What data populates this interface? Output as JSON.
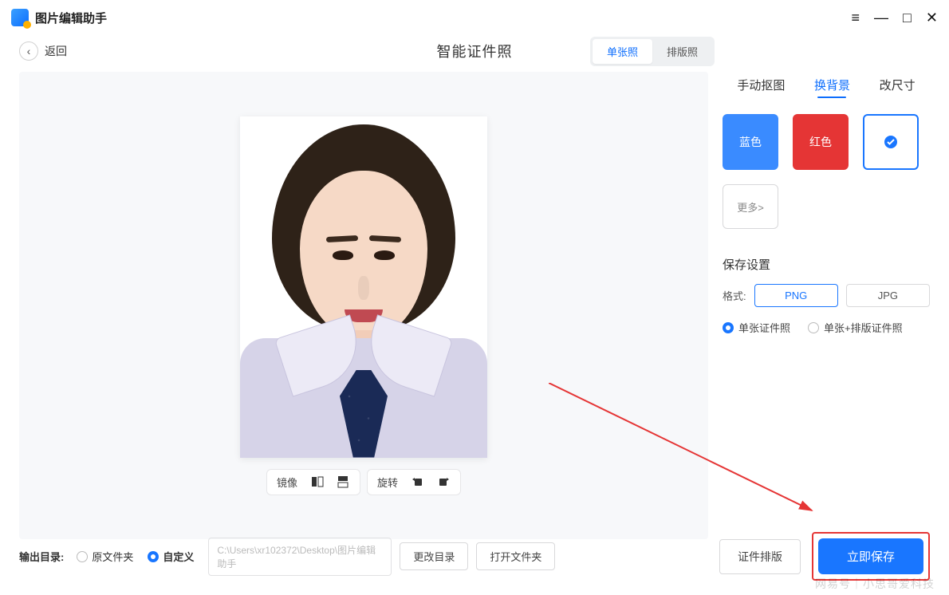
{
  "app": {
    "title": "图片编辑助手"
  },
  "window_controls": {
    "menu": "≡",
    "min": "—",
    "max": "□",
    "close": "✕"
  },
  "header": {
    "back_label": "返回",
    "page_title": "智能证件照",
    "segmented": {
      "options": [
        "单张照",
        "排版照"
      ],
      "active_index": 0
    }
  },
  "photo_toolbar": {
    "group1_label": "镜像",
    "group2_label": "旋转"
  },
  "side_tabs": {
    "items": [
      "手动抠图",
      "换背景",
      "改尺寸"
    ],
    "active_index": 1
  },
  "bg_swatches": {
    "blue": "蓝色",
    "red": "红色",
    "white_selected": true,
    "more": "更多>"
  },
  "save_settings": {
    "title": "保存设置",
    "format_label": "格式:",
    "formats": [
      "PNG",
      "JPG"
    ],
    "format_active_index": 0,
    "output_radios": [
      "单张证件照",
      "单张+排版证件照"
    ],
    "output_active_index": 0
  },
  "footer": {
    "output_dir_label": "输出目录:",
    "dir_radios": [
      "原文件夹",
      "自定义"
    ],
    "dir_active_index": 1,
    "path_placeholder": "C:\\Users\\xr102372\\Desktop\\图片编辑助手",
    "change_dir": "更改目录",
    "open_dir": "打开文件夹",
    "layout_btn": "证件排版",
    "save_btn": "立即保存"
  },
  "watermark": "网易号｜小思哥爱科技"
}
